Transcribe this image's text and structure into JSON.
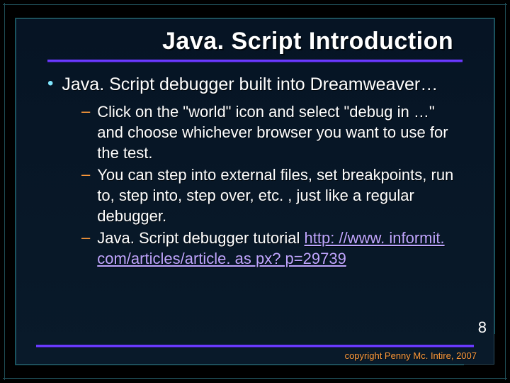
{
  "title": "Java. Script Introduction",
  "bullet": "Java. Script debugger built into Dreamweaver…",
  "subbullets": [
    "Click on the \"world\" icon and select \"debug in …\" and choose whichever browser you want to use for the test.",
    "You can step into external files, set breakpoints, run to, step into, step over, etc. , just like a regular debugger.",
    "Java. Script debugger tutorial "
  ],
  "tutorial_link": "http: //www. informit. com/articles/article. as px? p=29739",
  "page_number": "8",
  "copyright": "copyright Penny Mc. Intire, 2007"
}
